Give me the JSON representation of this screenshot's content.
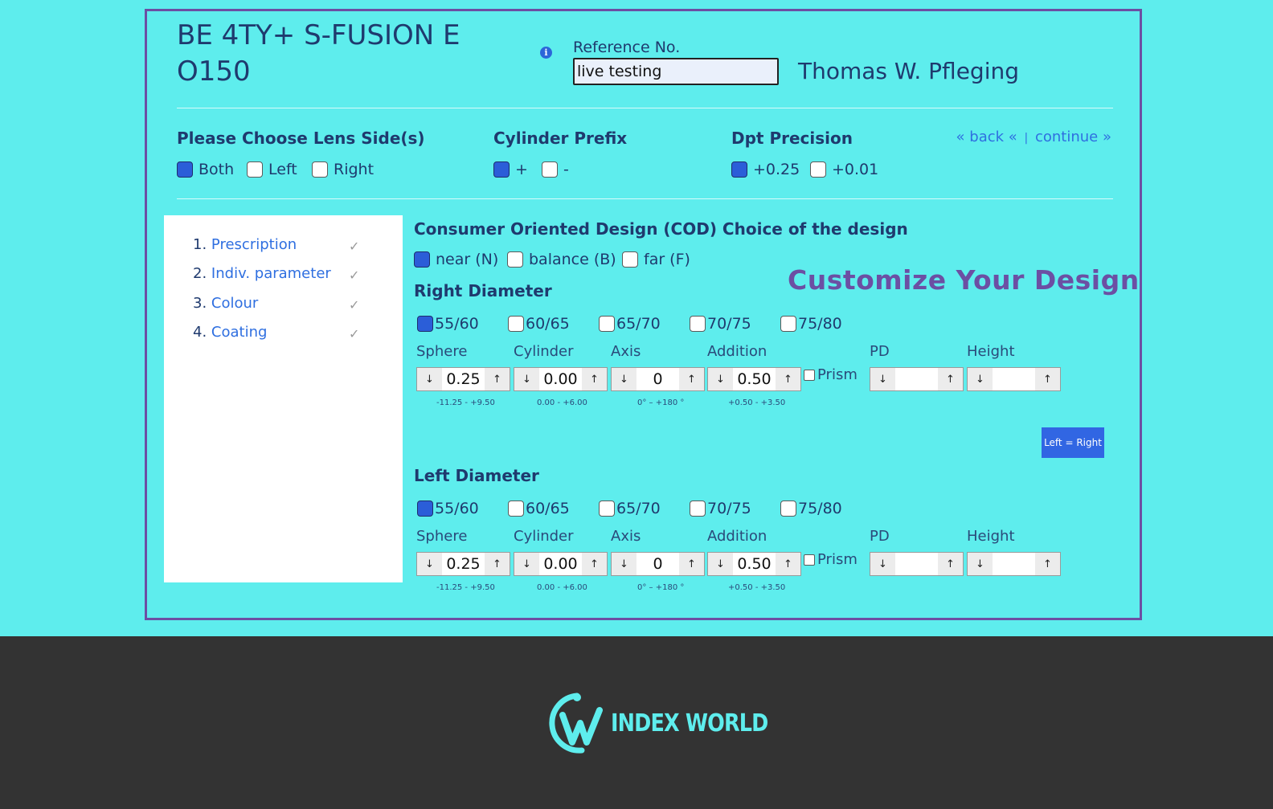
{
  "header": {
    "product_title": "BE 4TY+ S-FUSION E O150",
    "ref_label": "Reference No.",
    "ref_value": "live testing",
    "user_name": "Thomas W. Pfleging"
  },
  "lens_side": {
    "title": "Please Choose Lens Side(s)",
    "options": [
      {
        "label": "Both",
        "checked": true
      },
      {
        "label": "Left",
        "checked": false
      },
      {
        "label": "Right",
        "checked": false
      }
    ]
  },
  "cylinder_prefix": {
    "title": "Cylinder Prefix",
    "options": [
      {
        "label": "+",
        "checked": true
      },
      {
        "label": "-",
        "checked": false
      }
    ]
  },
  "dpt_precision": {
    "title": "Dpt Precision",
    "options": [
      {
        "label": "+0.25",
        "checked": true
      },
      {
        "label": "+0.01",
        "checked": false
      }
    ]
  },
  "nav": {
    "back": "« back «",
    "sep": "|",
    "continue": "continue »"
  },
  "steps": [
    {
      "num": "1.",
      "label": "Prescription",
      "check": "✓"
    },
    {
      "num": "2.",
      "label": "Indiv. parameter",
      "check": "✓"
    },
    {
      "num": "3.",
      "label": "Colour",
      "check": "✓"
    },
    {
      "num": "4.",
      "label": "Coating",
      "check": "✓"
    }
  ],
  "cod": {
    "title": "Consumer Oriented Design (COD) Choice of the design",
    "options": [
      {
        "label": "near (N)",
        "checked": true
      },
      {
        "label": "balance (B)",
        "checked": false
      },
      {
        "label": "far (F)",
        "checked": false
      }
    ]
  },
  "headline": "Customize Your  Design",
  "diameters": [
    "55/60",
    "60/65",
    "65/70",
    "70/75",
    "75/80"
  ],
  "field_labels": {
    "sphere": "Sphere",
    "cylinder": "Cylinder",
    "axis": "Axis",
    "addition": "Addition",
    "prism": "Prism",
    "pd": "PD",
    "height": "Height"
  },
  "ranges": {
    "sphere": "-11.25  -  +9.50",
    "cylinder": "0.00  -  +6.00",
    "axis": "0° – +180 °",
    "addition": "+0.50  -  +3.50"
  },
  "arrows": {
    "down": "↓",
    "up": "↑"
  },
  "right": {
    "title": "Right Diameter",
    "selected_diameter": "55/60",
    "sphere": "0.25",
    "cylinder": "0.00",
    "axis": "0",
    "addition": "0.50",
    "pd": "",
    "height": ""
  },
  "left": {
    "title": "Left Diameter",
    "selected_diameter": "55/60",
    "sphere": "0.25",
    "cylinder": "0.00",
    "axis": "0",
    "addition": "0.50",
    "pd": "",
    "height": ""
  },
  "copy_button": "Left = Right",
  "footer": {
    "logo_text": "INDEX WORLD",
    "colors": {
      "background": "#333333",
      "logo": "#5eeded"
    }
  },
  "colors": {
    "page_bg": "#5eeded",
    "frame": "#6c4fa3",
    "text": "#1f3a6e",
    "link": "#2f6fe0",
    "checked": "#2b5ed8",
    "button": "#3166e3"
  }
}
